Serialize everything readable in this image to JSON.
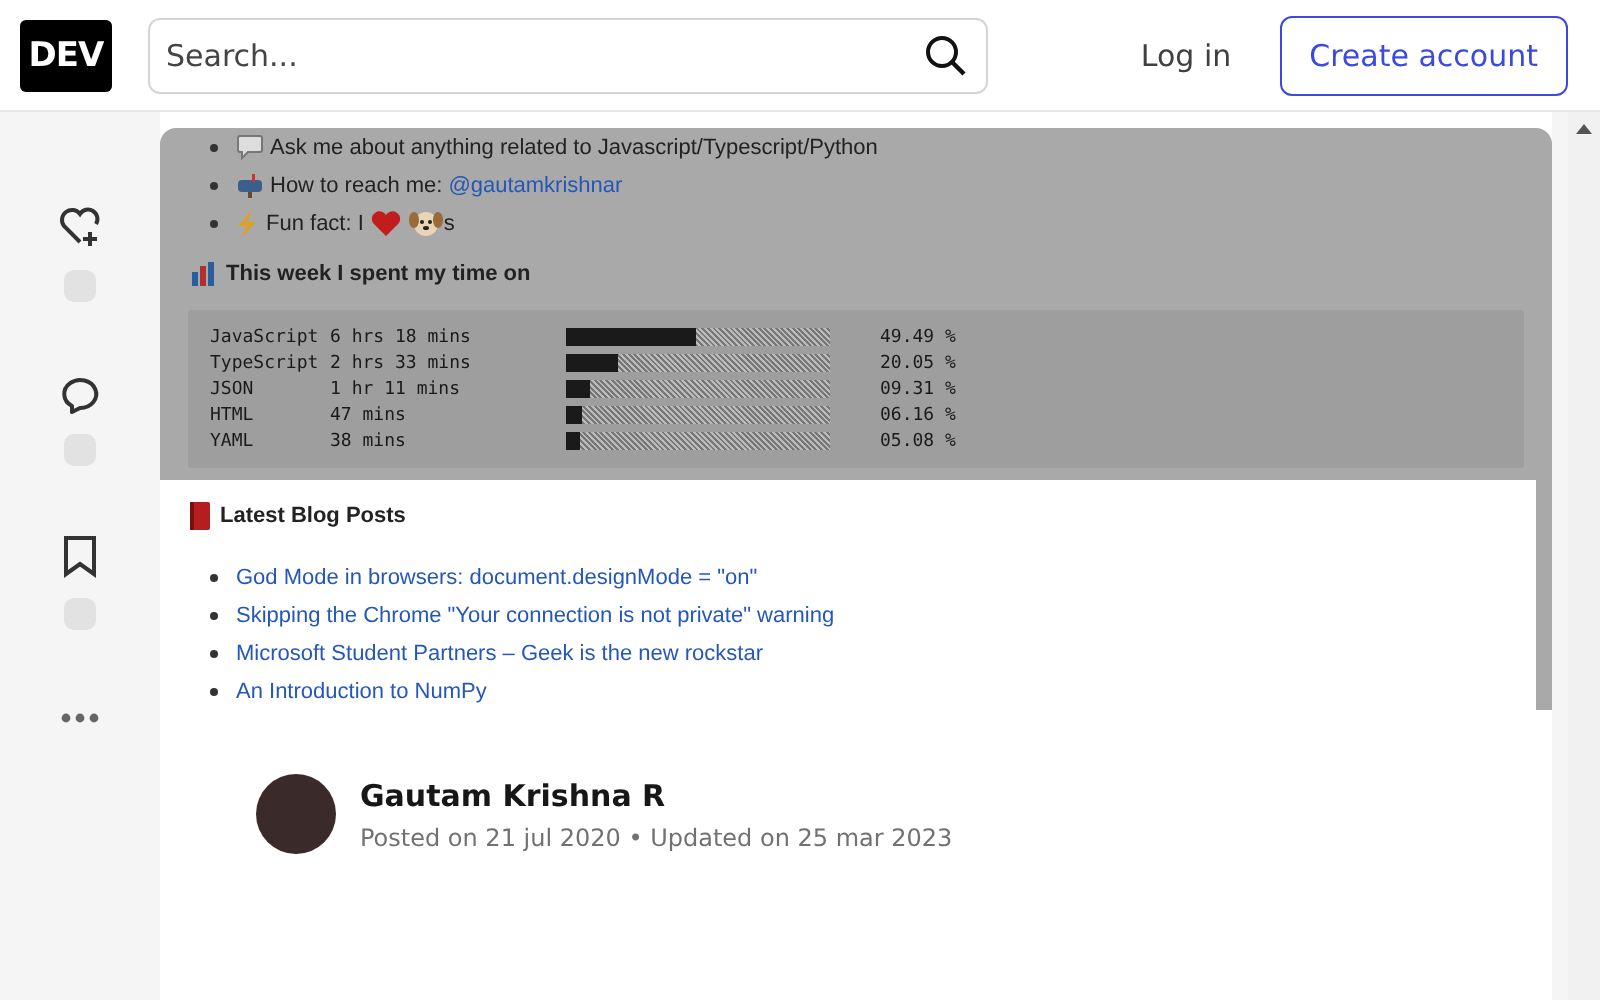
{
  "header": {
    "logo": "DEV",
    "search": {
      "placeholder": "Search..."
    },
    "login": "Log in",
    "create_account": "Create account"
  },
  "cover": {
    "bullets": [
      {
        "kind": "speech",
        "parts": [
          "Ask me about anything related to Javascript/Typescript/Python"
        ]
      },
      {
        "kind": "mailbox",
        "parts": [
          "How to reach me:"
        ],
        "link": "@gautamkrishnar"
      },
      {
        "kind": "lightning",
        "parts": [
          "Fun fact: I",
          "s"
        ]
      }
    ],
    "stats_heading": "This week I spent my time on",
    "stats": [
      {
        "name": "JavaScript",
        "time": "6 hrs 18 mins",
        "level": 0.4949,
        "percent": "49.49 %"
      },
      {
        "name": "TypeScript",
        "time": "2 hrs 33 mins",
        "level": 0.2005,
        "percent": "20.05 %"
      },
      {
        "name": "JSON",
        "time": "1 hr 11 mins",
        "level": 0.0931,
        "percent": "09.31 %"
      },
      {
        "name": "HTML",
        "time": "47 mins",
        "level": 0.0616,
        "percent": "06.16 %"
      },
      {
        "name": "YAML",
        "time": "38 mins",
        "level": 0.0508,
        "percent": "05.08 %"
      }
    ],
    "blog_heading": "Latest Blog Posts",
    "blog_posts": [
      "God Mode in browsers: document.designMode = \"on\"",
      "Skipping the Chrome \"Your connection is not private\" warning",
      "Microsoft Student Partners – Geek is the new rockstar",
      "An Introduction to NumPy"
    ]
  },
  "author": {
    "name": "Gautam Krishna R",
    "dates": "Posted on 21 jul 2020 • Updated on 25 mar 2023"
  }
}
